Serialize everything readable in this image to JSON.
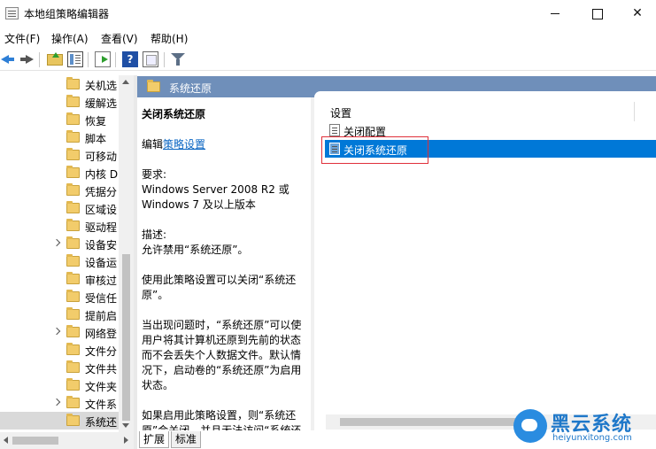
{
  "window": {
    "title": "本地组策略编辑器",
    "controls": {
      "minimize": "",
      "maximize": "",
      "close": "✕"
    }
  },
  "menu": [
    "文件(F)",
    "操作(A)",
    "查看(V)",
    "帮助(H)"
  ],
  "toolbar": {
    "icons": [
      "back-icon",
      "forward-icon",
      "up-folder-icon",
      "show-hide-tree-icon",
      "export-list-icon",
      "help-icon",
      "properties-icon",
      "filter-icon"
    ],
    "help_label": "?"
  },
  "tree": {
    "items": [
      {
        "label": "关机选",
        "expandable": false,
        "selected": false
      },
      {
        "label": "缓解选",
        "expandable": false,
        "selected": false
      },
      {
        "label": "恢复",
        "expandable": false,
        "selected": false
      },
      {
        "label": "脚本",
        "expandable": false,
        "selected": false
      },
      {
        "label": "可移动",
        "expandable": false,
        "selected": false
      },
      {
        "label": "内核 D",
        "expandable": false,
        "selected": false
      },
      {
        "label": "凭据分",
        "expandable": false,
        "selected": false
      },
      {
        "label": "区域设",
        "expandable": false,
        "selected": false
      },
      {
        "label": "驱动程",
        "expandable": false,
        "selected": false
      },
      {
        "label": "设备安",
        "expandable": true,
        "selected": false
      },
      {
        "label": "设备运",
        "expandable": false,
        "selected": false
      },
      {
        "label": "审核过",
        "expandable": false,
        "selected": false
      },
      {
        "label": "受信任",
        "expandable": false,
        "selected": false
      },
      {
        "label": "提前启",
        "expandable": false,
        "selected": false
      },
      {
        "label": "网络登",
        "expandable": true,
        "selected": false
      },
      {
        "label": "文件分",
        "expandable": false,
        "selected": false
      },
      {
        "label": "文件共",
        "expandable": false,
        "selected": false
      },
      {
        "label": "文件夹",
        "expandable": false,
        "selected": false
      },
      {
        "label": "文件系",
        "expandable": true,
        "selected": false
      },
      {
        "label": "系统还",
        "expandable": false,
        "selected": true
      }
    ]
  },
  "right_header": {
    "title": "系统还原"
  },
  "description": {
    "title": "关闭系统还原",
    "edit_prefix": "编辑",
    "edit_link": "策略设置",
    "requirements_label": "要求:",
    "requirements_text": "Windows Server 2008 R2 或 Windows 7 及以上版本",
    "description_label": "描述:",
    "description_text": "允许禁用“系统还原”。",
    "para1": "使用此策略设置可以关闭“系统还原”。",
    "para2": "当出现问题时，“系统还原”可以使用户将其计算机还原到先前的状态而不会丢失个人数据文件。默认情况下，启动卷的“系统还原”为启用状态。",
    "para3": "如果启用此策略设置，则“系统还原”会关闭，并且无法访问“系统还"
  },
  "settings": {
    "column_header": "设置",
    "items": [
      {
        "label": "关闭配置",
        "selected": false
      },
      {
        "label": "关闭系统还原",
        "selected": true
      }
    ]
  },
  "tabs": [
    "扩展",
    "标准"
  ],
  "watermark": {
    "name": "黑云系统",
    "domain": "heiyunxitong.com"
  },
  "colors": {
    "header_blue": "#6f8fba",
    "selection_blue": "#0078d7",
    "highlight_red": "#e0303a",
    "link_blue": "#0b66c3"
  }
}
